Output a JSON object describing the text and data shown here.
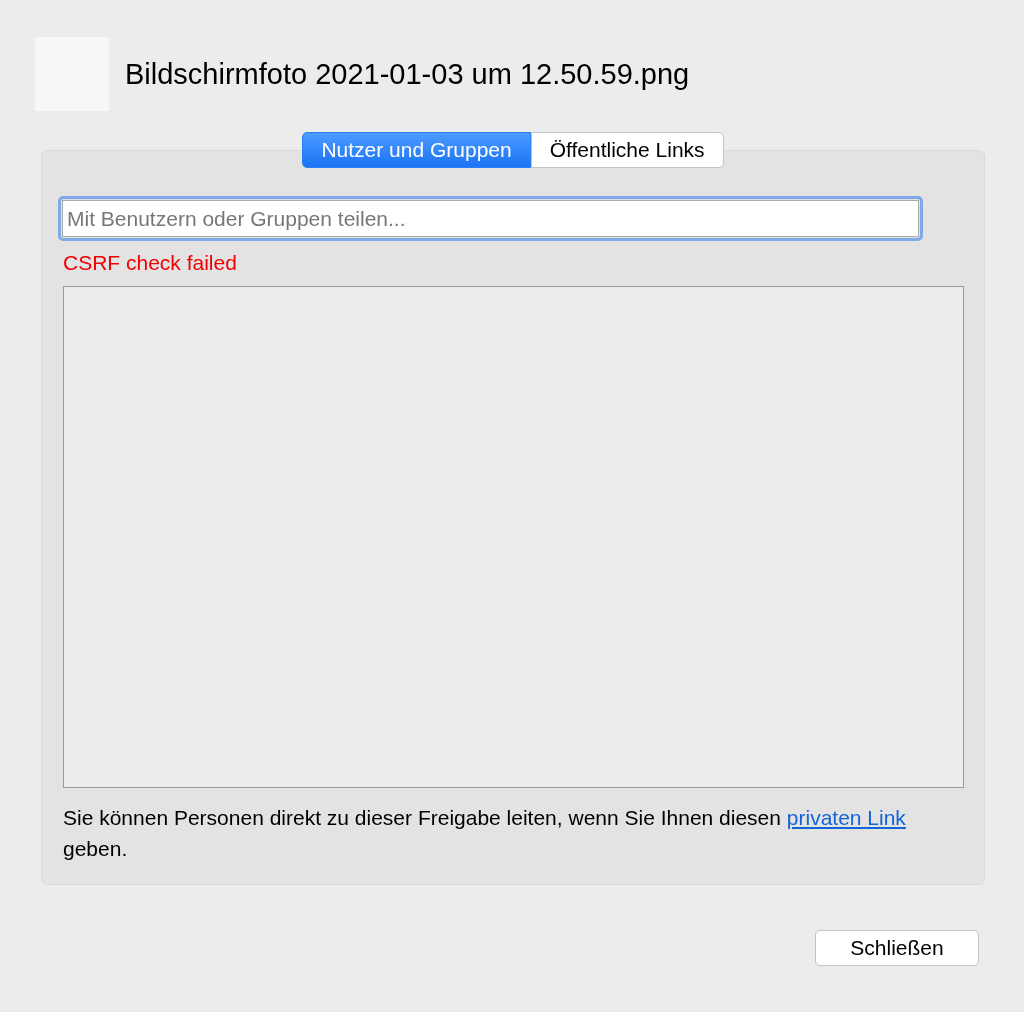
{
  "header": {
    "title": "Bildschirmfoto 2021-01-03 um 12.50.59.png"
  },
  "tabs": [
    {
      "label": "Nutzer und Gruppen",
      "selected": true
    },
    {
      "label": "Öffentliche Links",
      "selected": false
    }
  ],
  "share_field": {
    "placeholder": "Mit Benutzern oder Gruppen teilen...",
    "focused": true
  },
  "error": "CSRF check failed",
  "info": {
    "before": "Sie können Personen direkt zu dieser Freigabe leiten, wenn Sie Ihnen diesen ",
    "link": "privaten Link",
    "after": " geben."
  },
  "buttons": [
    {
      "label": "Schließen"
    }
  ]
}
